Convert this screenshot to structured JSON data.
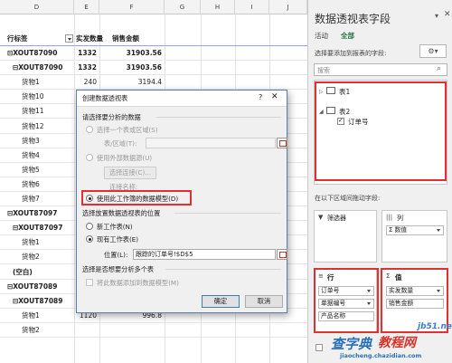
{
  "sheet": {
    "columns": [
      "D",
      "E",
      "F",
      "G",
      "H",
      "I",
      "J"
    ],
    "header": {
      "row_label": "行标签",
      "qty": "实发数量",
      "amount": "销售金额"
    },
    "rows": [
      {
        "label": "⊟XOUT87090",
        "qty": "1332",
        "amount": "31903.56",
        "level": 0,
        "bold": true
      },
      {
        "label": "⊟XOUT87090",
        "qty": "1332",
        "amount": "31903.56",
        "level": 1,
        "bold": true
      },
      {
        "label": "货物1",
        "qty": "240",
        "amount": "3194.4",
        "level": 2,
        "bold": false
      },
      {
        "label": "货物10",
        "qty": "",
        "amount": "",
        "level": 2,
        "bold": false
      },
      {
        "label": "货物11",
        "qty": "",
        "amount": "",
        "level": 2,
        "bold": false
      },
      {
        "label": "货物12",
        "qty": "",
        "amount": "",
        "level": 2,
        "bold": false
      },
      {
        "label": "货物3",
        "qty": "",
        "amount": "",
        "level": 2,
        "bold": false
      },
      {
        "label": "货物4",
        "qty": "",
        "amount": "",
        "level": 2,
        "bold": false
      },
      {
        "label": "货物5",
        "qty": "",
        "amount": "",
        "level": 2,
        "bold": false
      },
      {
        "label": "货物6",
        "qty": "",
        "amount": "",
        "level": 2,
        "bold": false
      },
      {
        "label": "货物7",
        "qty": "",
        "amount": "",
        "level": 2,
        "bold": false
      },
      {
        "label": "⊟XOUT87097",
        "qty": "",
        "amount": "",
        "level": 0,
        "bold": true
      },
      {
        "label": "⊟XOUT87097",
        "qty": "",
        "amount": "",
        "level": 1,
        "bold": true
      },
      {
        "label": "货物1",
        "qty": "",
        "amount": "",
        "level": 2,
        "bold": false
      },
      {
        "label": "货物2",
        "qty": "",
        "amount": "",
        "level": 2,
        "bold": false
      },
      {
        "label": "(空白)",
        "qty": "",
        "amount": "",
        "level": 1,
        "bold": true
      },
      {
        "label": "⊟XOUT87089",
        "qty": "1388",
        "amount": "5427.32",
        "level": 0,
        "bold": true
      },
      {
        "label": "⊟XOUT87089",
        "qty": "1388",
        "amount": "5427.32",
        "level": 1,
        "bold": true
      },
      {
        "label": "货物1",
        "qty": "1120",
        "amount": "996.8",
        "level": 2,
        "bold": false
      },
      {
        "label": "货物2",
        "qty": "",
        "amount": "",
        "level": 2,
        "bold": false
      }
    ]
  },
  "dialog": {
    "title": "创建数据透视表",
    "section1": "请选择要分析的数据",
    "opt_table_range": "选择一个表或区域(S)",
    "table_range_label": "表/区域(T):",
    "opt_external": "使用外部数据源(U)",
    "choose_connection": "选择连接(C)...",
    "connection_name": "连接名称:",
    "opt_data_model": "使用此工作簿的数据模型(D)",
    "section2": "选择放置数据透视表的位置",
    "opt_new_sheet": "新工作表(N)",
    "opt_existing_sheet": "现有工作表(E)",
    "location_label": "位置(L):",
    "location_value": "跟踪的订单号!$D$5",
    "section3": "选择是否想要分析多个表",
    "add_to_model": "将此数据添加到数据模型(M)",
    "ok": "确定",
    "cancel": "取消"
  },
  "pane": {
    "title": "数据透视表字段",
    "tab_active": "活动",
    "tab_all": "全部",
    "choose_fields": "选择要添加到报表的字段:",
    "search_placeholder": "搜索",
    "tables": [
      {
        "name": "表1",
        "expanded": false
      },
      {
        "name": "表2",
        "expanded": true
      }
    ],
    "field": "订单号",
    "drag_hint": "在以下区域间拖动字段:",
    "filters_label": "筛选器",
    "columns_label": "列",
    "columns_item": "Σ 数值",
    "rows_label": "行",
    "rows_items": [
      "订单号",
      "单据编号",
      "产品名称"
    ],
    "values_label": "值",
    "values_items": [
      "实发数量",
      "销售金额"
    ]
  },
  "watermark": {
    "site": "jb51.net",
    "main": "查字典",
    "sub": "教程网",
    "url": "jiaocheng.chazidian.com"
  },
  "colors": {
    "highlight": "#e03030",
    "excel_green": "#217346",
    "blue": "#1f5fa8"
  }
}
